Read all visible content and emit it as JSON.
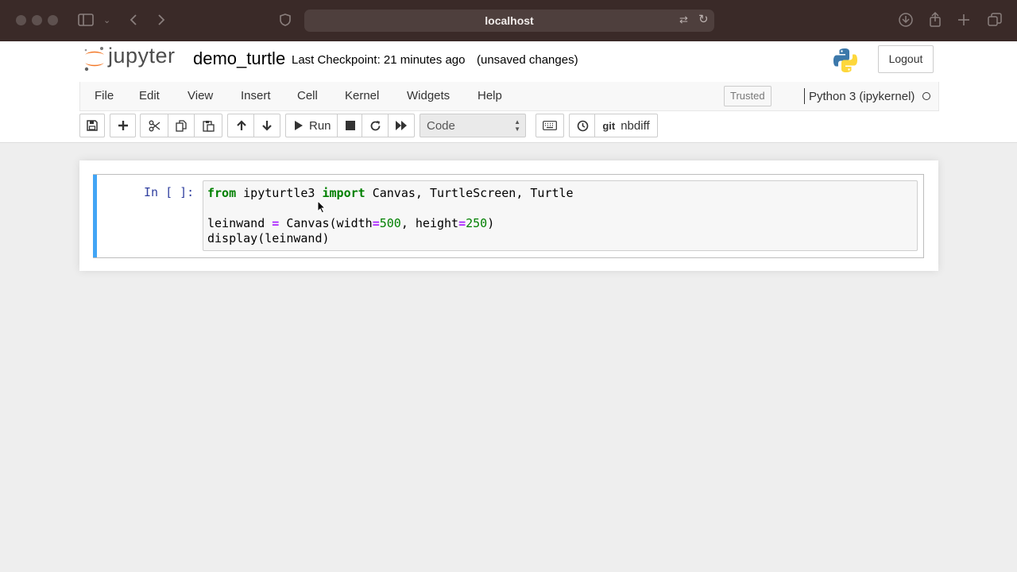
{
  "browser": {
    "url": "localhost"
  },
  "header": {
    "logo_text": "jupyter",
    "notebook_name": "demo_turtle",
    "checkpoint": "Last Checkpoint: 21 minutes ago",
    "status": "(unsaved changes)",
    "logout_label": "Logout"
  },
  "menu": {
    "items": [
      "File",
      "Edit",
      "View",
      "Insert",
      "Cell",
      "Kernel",
      "Widgets",
      "Help"
    ],
    "trusted_label": "Trusted",
    "kernel_name": "Python 3 (ipykernel)"
  },
  "toolbar": {
    "run_label": "Run",
    "cell_type": "Code",
    "git_label": "git",
    "nbdiff_label": "nbdiff",
    "icons": [
      "save-icon",
      "plus-icon",
      "cut-icon",
      "copy-icon",
      "paste-icon",
      "arrow-up-icon",
      "arrow-down-icon",
      "run-icon",
      "stop-icon",
      "restart-icon",
      "fast-forward-icon",
      "keyboard-icon",
      "history-icon"
    ]
  },
  "cell": {
    "prompt": "In [ ]:",
    "code": {
      "line1": {
        "kw1": "from",
        "module": " ipyturtle3 ",
        "kw2": "import",
        "names": " Canvas, TurtleScreen, Turtle"
      },
      "line2": "",
      "line3": {
        "var": "leinwand ",
        "eq1": "=",
        "call": " Canvas(width",
        "eq2": "=",
        "w": "500",
        "sep": ", height",
        "eq3": "=",
        "h": "250",
        "close": ")"
      },
      "line4": "display(leinwand)"
    }
  },
  "colors": {
    "accent": "#42a5f5",
    "keyword": "#008000",
    "operator": "#aa22ff",
    "prompt": "#303f9f"
  }
}
